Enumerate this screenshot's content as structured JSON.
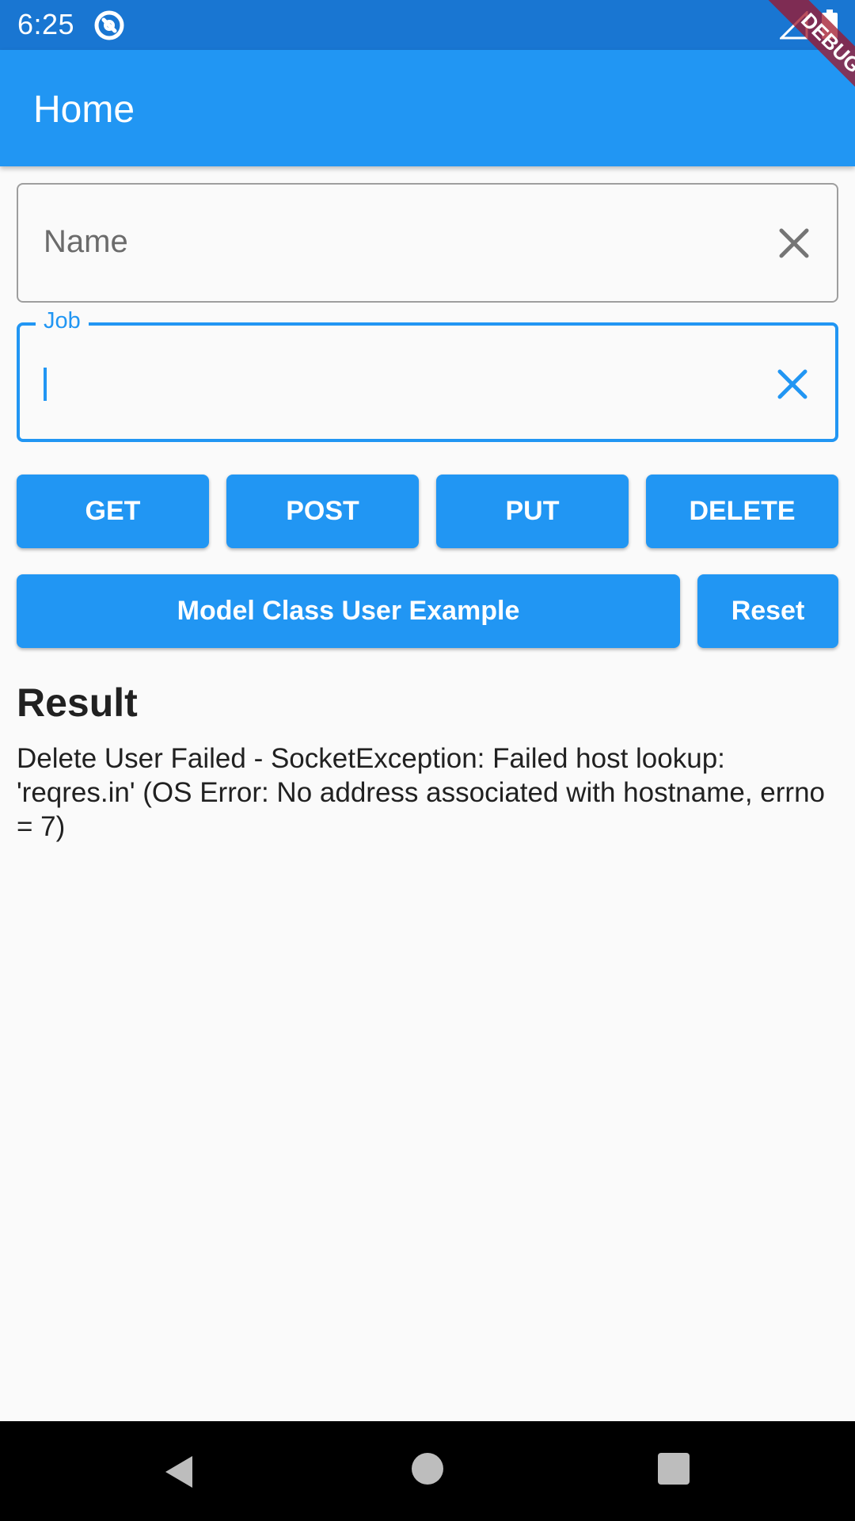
{
  "status_bar": {
    "time": "6:25",
    "icons": [
      "app-notification-icon",
      "signal-icon",
      "battery-icon"
    ]
  },
  "app_bar": {
    "title": "Home"
  },
  "debug_banner": {
    "label": "DEBUG"
  },
  "form": {
    "name_field": {
      "placeholder": "Name",
      "value": ""
    },
    "job_field": {
      "label": "Job",
      "value": ""
    }
  },
  "buttons": {
    "get": "GET",
    "post": "POST",
    "put": "PUT",
    "delete": "DELETE",
    "model": "Model Class User Example",
    "reset": "Reset"
  },
  "result": {
    "heading": "Result",
    "text": "Delete User Failed - SocketException: Failed host lookup: 'reqres.in' (OS Error: No address associated with hostname, errno = 7)"
  },
  "nav_bar": {
    "icons": [
      "back-icon",
      "home-icon",
      "recents-icon"
    ]
  },
  "colors": {
    "primary": "#2196f3",
    "status_bar": "#1976d2",
    "background": "#fafafa"
  }
}
